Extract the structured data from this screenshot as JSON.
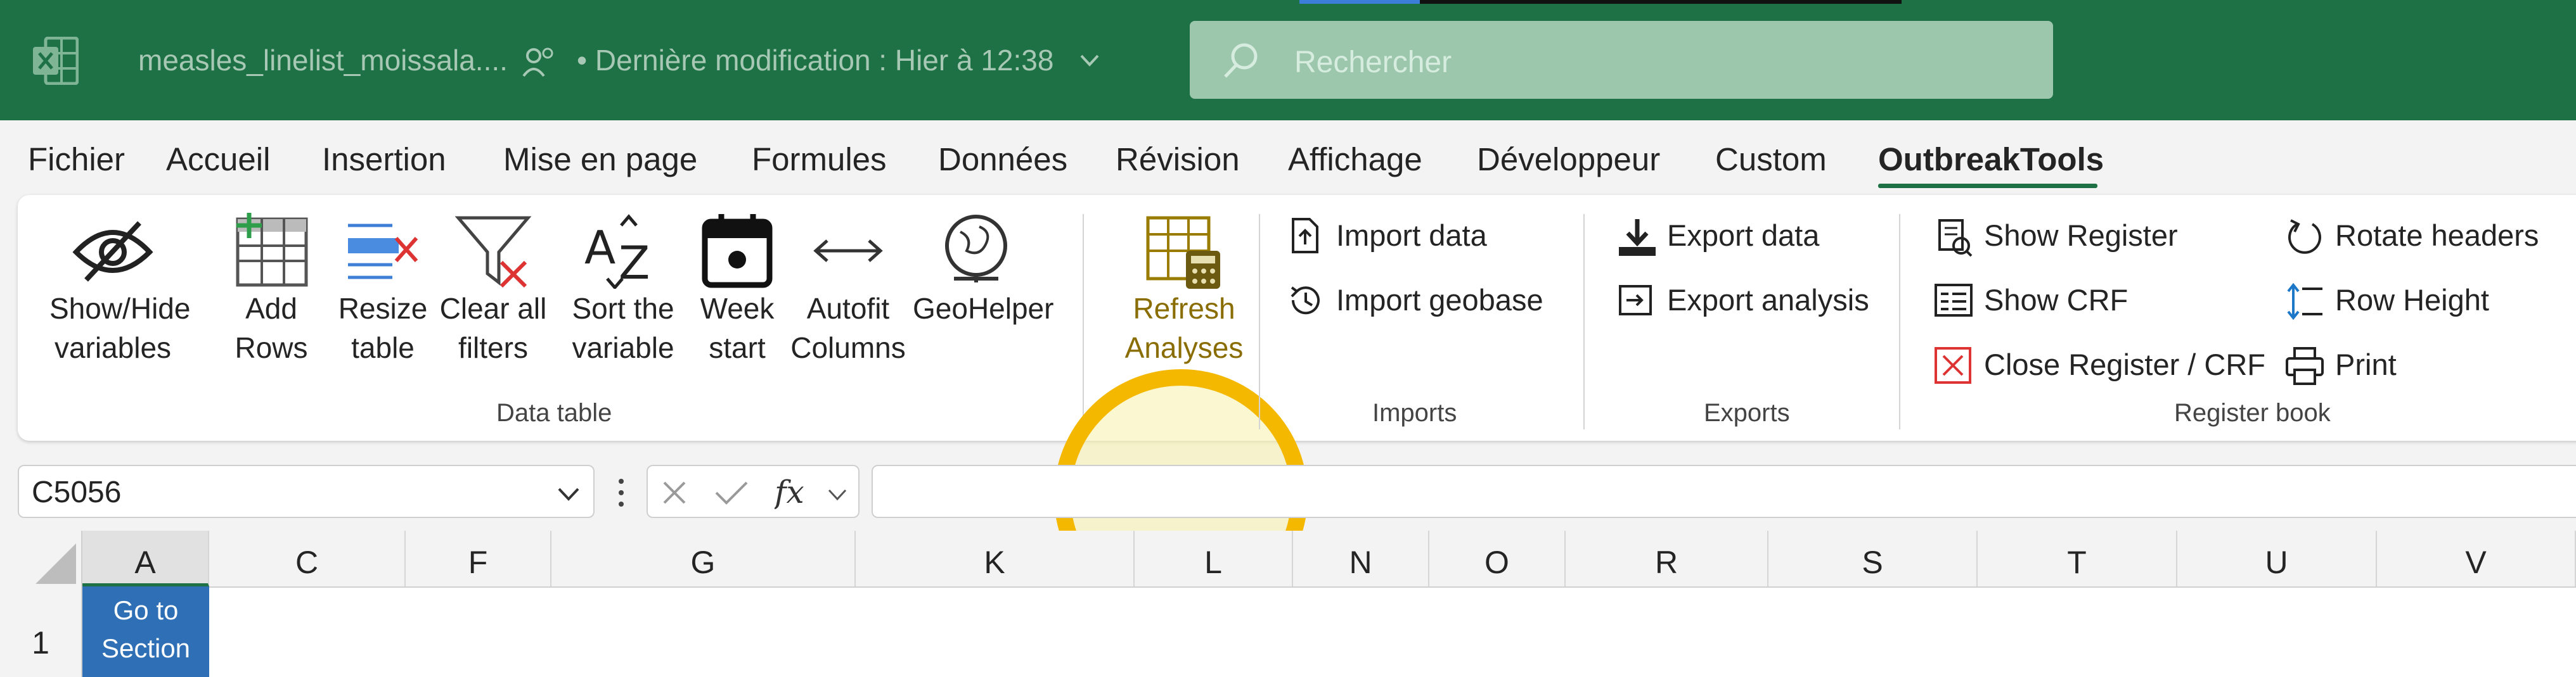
{
  "titlebar": {
    "filename": "measles_linelist_moissala....",
    "modified": "• Dernière modification : Hier à 12:38",
    "search_placeholder": "Rechercher"
  },
  "menu": {
    "tabs": [
      "Fichier",
      "Accueil",
      "Insertion",
      "Mise en page",
      "Formules",
      "Données",
      "Révision",
      "Affichage",
      "Développeur",
      "Custom",
      "OutbreakTools"
    ],
    "active_tab": "OutbreakTools"
  },
  "ribbon": {
    "data_table": {
      "group_label": "Data table",
      "show_hide": [
        "Show/Hide",
        "variables"
      ],
      "add_rows": [
        "Add",
        "Rows"
      ],
      "resize_table": [
        "Resize",
        "table"
      ],
      "clear_filters": [
        "Clear all",
        "filters"
      ],
      "sort_variable": [
        "Sort the",
        "variable"
      ],
      "week_start": [
        "Week",
        "start"
      ],
      "autofit": [
        "Autofit",
        "Columns"
      ],
      "geohelper": "GeoHelper"
    },
    "refresh": [
      "Refresh",
      "Analyses"
    ],
    "imports": {
      "group_label": "Imports",
      "import_data": "Import data",
      "import_geobase": "Import geobase"
    },
    "exports": {
      "group_label": "Exports",
      "export_data": "Export data",
      "export_analysis": "Export analysis"
    },
    "register_book": {
      "group_label": "Register book",
      "show_register": "Show Register",
      "show_crf": "Show CRF",
      "close_register": "Close Register / CRF",
      "rotate_headers": "Rotate headers",
      "row_height": "Row Height",
      "print": "Print"
    }
  },
  "formula_bar": {
    "name_box": "C5056",
    "formula": ""
  },
  "grid": {
    "columns": [
      "A",
      "C",
      "F",
      "G",
      "K",
      "L",
      "N",
      "O",
      "R",
      "S",
      "T",
      "U",
      "V"
    ],
    "rows": [
      "1"
    ],
    "cell_a1": [
      "Go to",
      "Section"
    ]
  },
  "colors": {
    "titlebar": "#1e7145",
    "highlight_ring": "#f5b800",
    "cell_a1_fill": "#2f6fb6"
  }
}
